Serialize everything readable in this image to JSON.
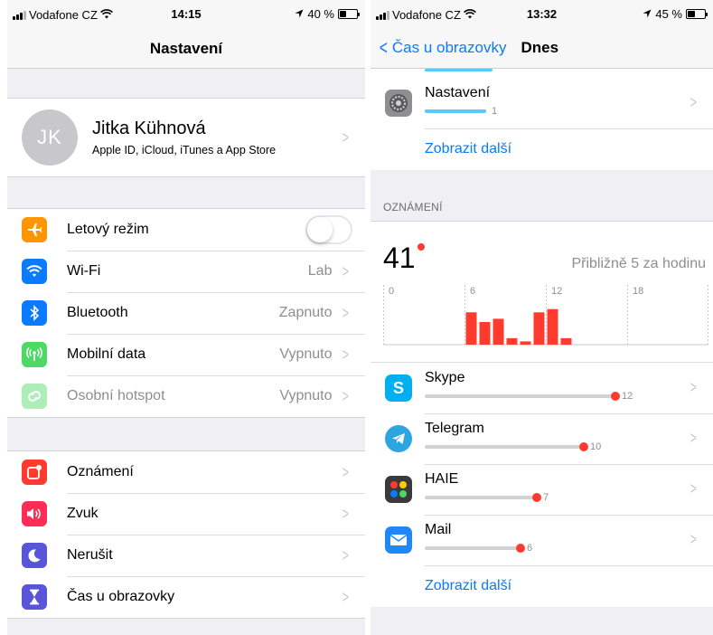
{
  "left": {
    "status": {
      "carrier": "Vodafone CZ",
      "time": "14:15",
      "battery": "40 %"
    },
    "title": "Nastavení",
    "profile": {
      "initials": "JK",
      "name": "Jitka Kühnová",
      "subtitle": "Apple ID, iCloud, iTunes a App Store"
    },
    "network": [
      {
        "label": "Letový režim",
        "value": "",
        "icon": "airplane-icon",
        "color": "#ff9500"
      },
      {
        "label": "Wi-Fi",
        "value": "Lab",
        "icon": "wifi-icon",
        "color": "#0a7aff"
      },
      {
        "label": "Bluetooth",
        "value": "Zapnuto",
        "icon": "bluetooth-icon",
        "color": "#0a7aff"
      },
      {
        "label": "Mobilní data",
        "value": "Vypnuto",
        "icon": "antenna-icon",
        "color": "#4cd964"
      },
      {
        "label": "Osobní hotspot",
        "value": "Vypnuto",
        "icon": "hotspot-icon",
        "color": "#4cd964"
      }
    ],
    "general": [
      {
        "label": "Oznámení",
        "icon": "notifications-icon",
        "color": "#ff3b30"
      },
      {
        "label": "Zvuk",
        "icon": "speaker-icon",
        "color": "#ff2d55"
      },
      {
        "label": "Nerušit",
        "icon": "moon-icon",
        "color": "#5856d6"
      },
      {
        "label": "Čas u obrazovky",
        "icon": "hourglass-icon",
        "color": "#5856d6"
      }
    ]
  },
  "right": {
    "status": {
      "carrier": "Vodafone CZ",
      "time": "13:32",
      "battery": "45 %"
    },
    "back_label": "Čas u obrazovky",
    "title": "Dnes",
    "top_app": {
      "name": "Nastavení",
      "count": "1",
      "icon": "settings-gear-icon"
    },
    "show_more": "Zobrazit další",
    "notifications_header": "OZNÁMENÍ",
    "total": "41",
    "per_hour": "Přibližně 5 za hodinu",
    "apps": [
      {
        "name": "Skype",
        "count": 12,
        "icon": "skype-icon",
        "color": "#00aff0"
      },
      {
        "name": "Telegram",
        "count": 10,
        "icon": "telegram-icon",
        "color": "#2ca5e0"
      },
      {
        "name": "HAIE",
        "count": 7,
        "icon": "haie-icon",
        "color": "#3a3a3c"
      },
      {
        "name": "Mail",
        "count": 6,
        "icon": "mail-icon",
        "color": "#1e88f5"
      }
    ],
    "show_more_2": "Zobrazit další",
    "chart_data": {
      "type": "bar",
      "x_ticks": [
        "0",
        "6",
        "12",
        "18"
      ],
      "hours": [
        6,
        7,
        8,
        9,
        10,
        11,
        12,
        13,
        14
      ],
      "values": [
        10,
        7,
        8,
        2,
        1,
        10,
        11,
        2,
        0
      ],
      "ylim": [
        0,
        14
      ],
      "bar_color": "#ff3b30"
    }
  }
}
